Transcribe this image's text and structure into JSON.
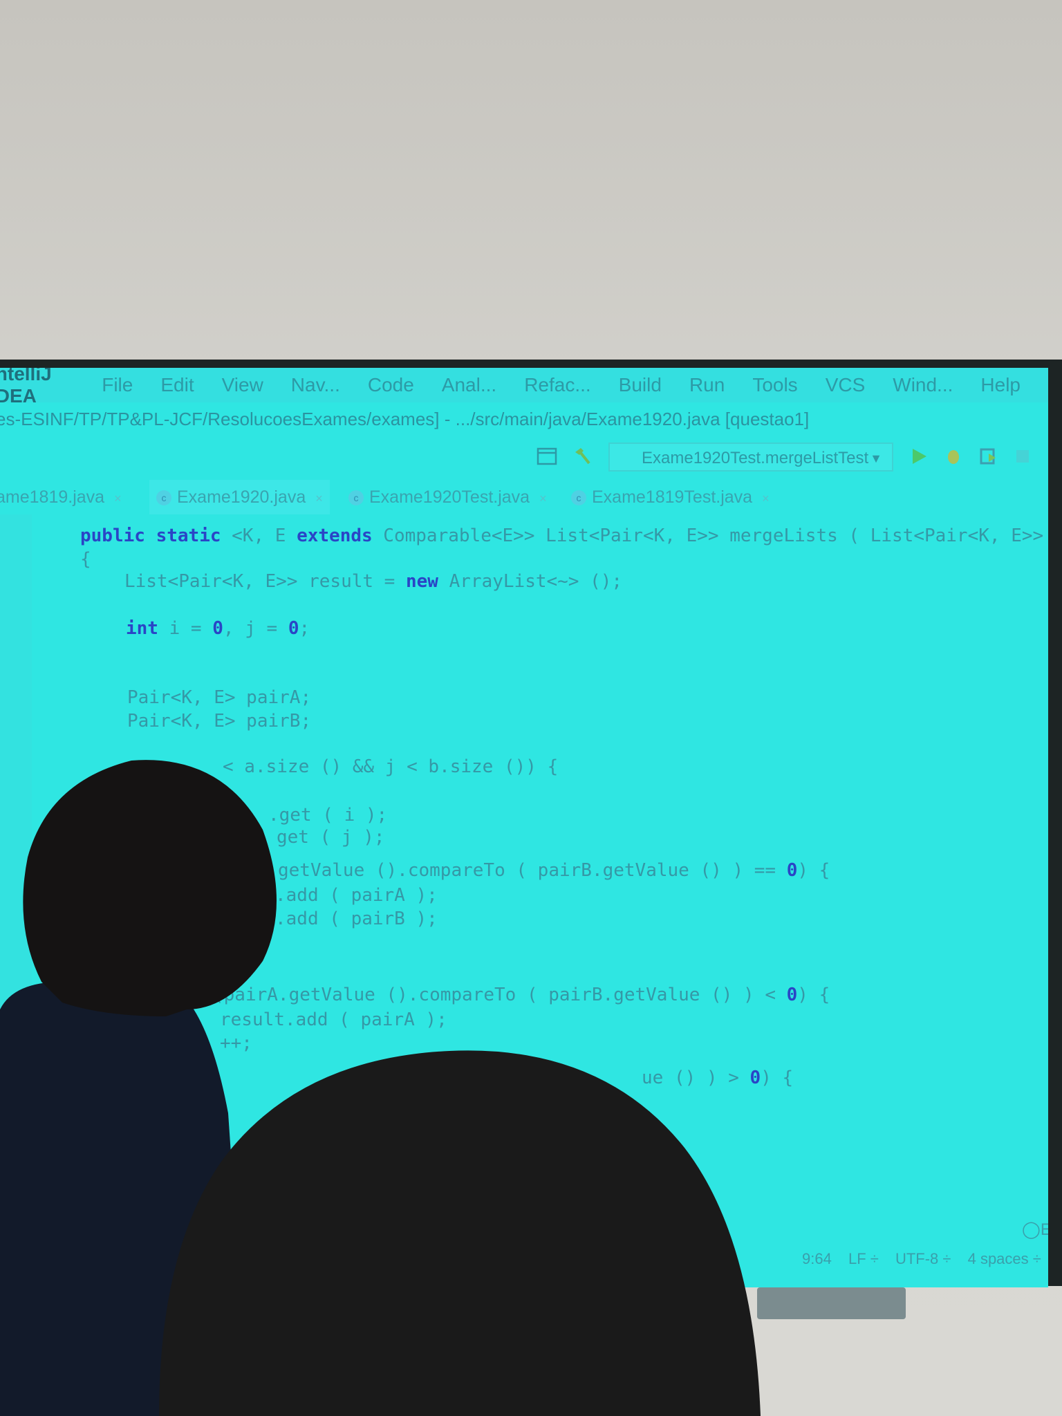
{
  "menubar": {
    "app_name": "IntelliJ IDEA",
    "items": [
      "File",
      "Edit",
      "View",
      "Nav...",
      "Code",
      "Anal...",
      "Refac...",
      "Build",
      "Run",
      "Tools",
      "VCS",
      "Wind...",
      "Help"
    ]
  },
  "title_path": "es-ESINF/TP/TP&PL-JCF/ResolucoesExames/exames] - .../src/main/java/Exame1920.java [questao1]",
  "toolbar": {
    "run_config": "Exame1920Test.mergeListTest",
    "icons": [
      "layout-icon",
      "build-hammer-icon",
      "run-icon",
      "debug-icon",
      "coverage-icon",
      "stop-icon"
    ]
  },
  "tabs": [
    {
      "label": "ame1819.java"
    },
    {
      "label": "Exame1920.java",
      "active": true
    },
    {
      "label": "Exame1920Test.java"
    },
    {
      "label": "Exame1819Test.java"
    }
  ],
  "code_lines": [
    "public static <K, E extends Comparable<E>> List<Pair<K, E>> mergeLists ( List<Pair<K, E>> a, List<P",
    "{",
    "List<Pair<K, E>> result = new ArrayList<~> ();",
    "int i = 0, j = 0;",
    "Pair<K, E> pairA;",
    "Pair<K, E> pairB;",
    "< a.size () && j < b.size ()) {",
    ".get ( i );",
    "get ( j );",
    "getValue ().compareTo ( pairB.getValue () ) == 0) {",
    ".add ( pairA );",
    ".add ( pairB );",
    ";",
    "(pairA.getValue ().compareTo ( pairB.getValue () ) < 0) {",
    "result.add ( pairA );",
    "++;",
    "ue () ) > 0) {"
  ],
  "status_bar": {
    "position": "9:64",
    "line_sep": "LF ÷",
    "encoding": "UTF-8 ÷",
    "indent": "4 spaces ÷",
    "event_log": "E"
  },
  "colors": {
    "screen": "#2fe6e2",
    "keyword": "#2a45c6",
    "text": "#3598a6"
  }
}
